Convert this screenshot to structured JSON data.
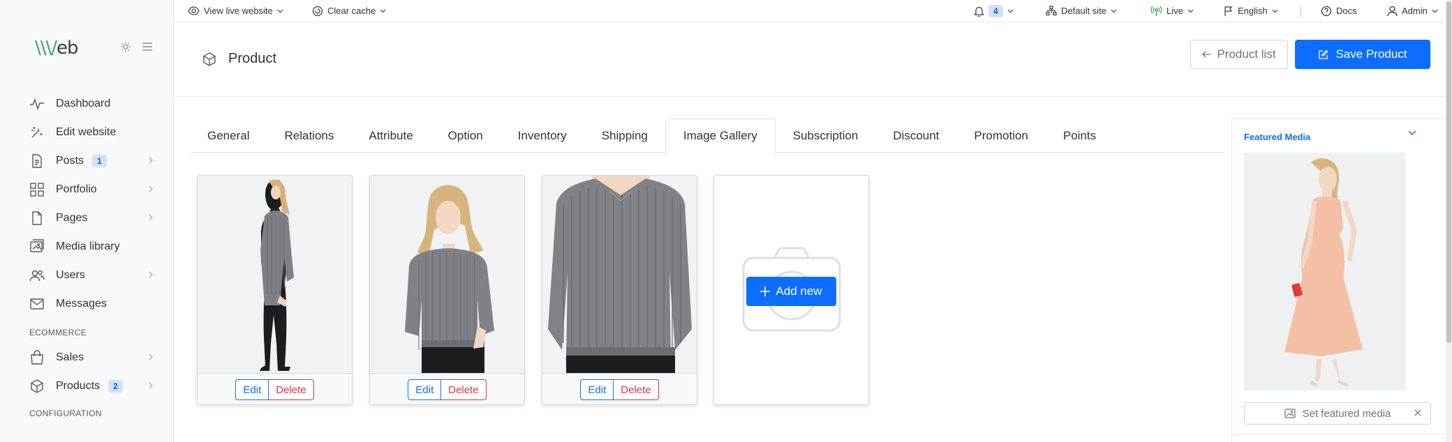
{
  "brand": {
    "logo_prefix": "\\\\\\/",
    "logo_suffix": "eb"
  },
  "sidebar": {
    "items": [
      {
        "label": "Dashboard",
        "icon": "pulse-icon"
      },
      {
        "label": "Edit website",
        "icon": "magic-wand-icon"
      },
      {
        "label": "Posts",
        "icon": "document-icon",
        "badge": "1"
      },
      {
        "label": "Portfolio",
        "icon": "grid-icon"
      },
      {
        "label": "Pages",
        "icon": "page-icon"
      },
      {
        "label": "Media library",
        "icon": "images-icon"
      },
      {
        "label": "Users",
        "icon": "users-icon"
      },
      {
        "label": "Messages",
        "icon": "envelope-icon"
      }
    ],
    "section_ecommerce": "ECOMMERCE",
    "ecommerce_items": [
      {
        "label": "Sales",
        "icon": "shopping-bag-icon"
      },
      {
        "label": "Products",
        "icon": "box-icon",
        "badge": "2"
      }
    ],
    "section_configuration": "CONFIGURATION"
  },
  "topbar": {
    "view_live": "View live website",
    "clear_cache": "Clear cache",
    "notifications_count": "4",
    "site": "Default site",
    "status": "Live",
    "language": "English",
    "docs": "Docs",
    "user": "Admin"
  },
  "header": {
    "title": "Product",
    "product_list_label": "Product list",
    "save_label": "Save Product"
  },
  "tabs": [
    "General",
    "Relations",
    "Attribute",
    "Option",
    "Inventory",
    "Shipping",
    "Image Gallery",
    "Subscription",
    "Discount",
    "Promotion",
    "Points"
  ],
  "active_tab": "Image Gallery",
  "gallery": {
    "edit_label": "Edit",
    "delete_label": "Delete",
    "add_new_label": "Add new"
  },
  "featured_media": {
    "title": "Featured Media",
    "set_label": "Set featured media"
  },
  "colors": {
    "primary": "#0d6efd",
    "danger": "#dc3545",
    "brand_green": "#3ba55c"
  }
}
